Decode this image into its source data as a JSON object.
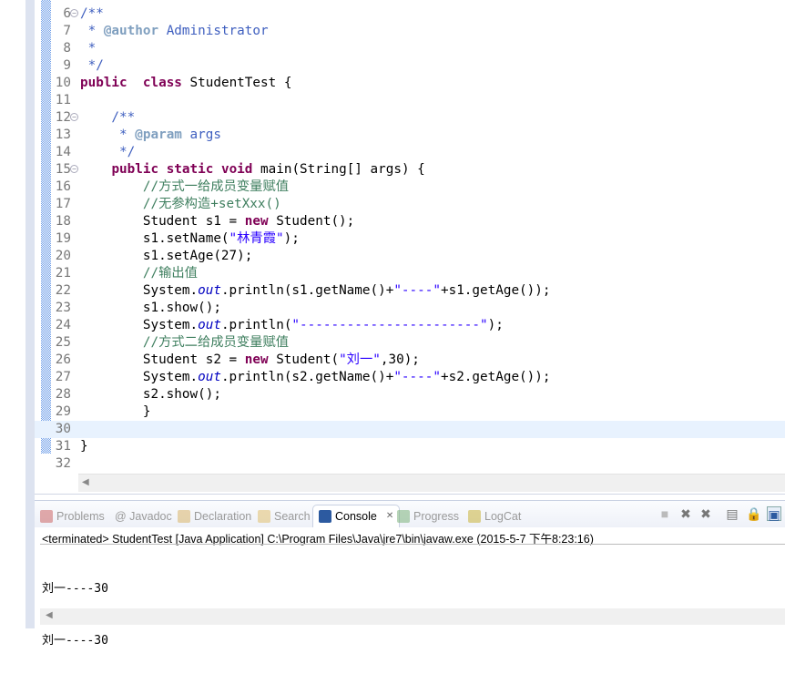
{
  "editor": {
    "current_line": 30,
    "lines": [
      {
        "n": "6",
        "fold": true,
        "t": [
          [
            "jd",
            "/**"
          ]
        ]
      },
      {
        "n": "7",
        "t": [
          [
            "jd",
            " * "
          ],
          [
            "tag",
            "@author"
          ],
          [
            "jd",
            " Administrator"
          ]
        ]
      },
      {
        "n": "8",
        "t": [
          [
            "jd",
            " *"
          ]
        ]
      },
      {
        "n": "9",
        "t": [
          [
            "jd",
            " */"
          ]
        ]
      },
      {
        "n": "10",
        "t": [
          [
            "kw",
            "public"
          ],
          [
            "",
            "  "
          ],
          [
            "kw",
            "class"
          ],
          [
            "",
            " StudentTest {"
          ]
        ]
      },
      {
        "n": "11",
        "t": []
      },
      {
        "n": "12",
        "fold": true,
        "t": [
          [
            "jd",
            "    /**"
          ]
        ]
      },
      {
        "n": "13",
        "t": [
          [
            "jd",
            "     * "
          ],
          [
            "tag",
            "@param"
          ],
          [
            "jd",
            " args"
          ]
        ]
      },
      {
        "n": "14",
        "t": [
          [
            "jd",
            "     */"
          ]
        ]
      },
      {
        "n": "15",
        "fold": true,
        "t": [
          [
            "",
            "    "
          ],
          [
            "kw",
            "public"
          ],
          [
            "",
            " "
          ],
          [
            "kw",
            "static"
          ],
          [
            "",
            " "
          ],
          [
            "kw",
            "void"
          ],
          [
            "",
            " main(String[] args) {"
          ]
        ]
      },
      {
        "n": "16",
        "t": [
          [
            "cm",
            "        //方式一给成员变量赋值"
          ]
        ]
      },
      {
        "n": "17",
        "t": [
          [
            "cm",
            "        //无参构造+setXxx()"
          ]
        ]
      },
      {
        "n": "18",
        "t": [
          [
            "",
            "        Student s1 = "
          ],
          [
            "kw",
            "new"
          ],
          [
            "",
            " Student();"
          ]
        ]
      },
      {
        "n": "19",
        "t": [
          [
            "",
            "        s1.setName("
          ],
          [
            "str",
            "\"林青霞\""
          ],
          [
            "",
            ");"
          ]
        ]
      },
      {
        "n": "20",
        "t": [
          [
            "",
            "        s1.setAge(27);"
          ]
        ]
      },
      {
        "n": "21",
        "t": [
          [
            "cm",
            "        //输出值"
          ]
        ]
      },
      {
        "n": "22",
        "t": [
          [
            "",
            "        System."
          ],
          [
            "fld",
            "out"
          ],
          [
            "",
            ".println(s1.getName()+"
          ],
          [
            "str",
            "\"----\""
          ],
          [
            "",
            "+s1.getAge());"
          ]
        ]
      },
      {
        "n": "23",
        "t": [
          [
            "",
            "        s1.show();"
          ]
        ]
      },
      {
        "n": "24",
        "t": [
          [
            "",
            "        System."
          ],
          [
            "fld",
            "out"
          ],
          [
            "",
            ".println("
          ],
          [
            "str",
            "\"-----------------------\""
          ],
          [
            "",
            ");"
          ]
        ]
      },
      {
        "n": "25",
        "t": [
          [
            "cm",
            "        //方式二给成员变量赋值"
          ]
        ]
      },
      {
        "n": "26",
        "t": [
          [
            "",
            "        Student s2 = "
          ],
          [
            "kw",
            "new"
          ],
          [
            "",
            " Student("
          ],
          [
            "str",
            "\"刘一\""
          ],
          [
            "",
            ",30);"
          ]
        ]
      },
      {
        "n": "27",
        "t": [
          [
            "",
            "        System."
          ],
          [
            "fld",
            "out"
          ],
          [
            "",
            ".println(s2.getName()+"
          ],
          [
            "str",
            "\"----\""
          ],
          [
            "",
            "+s2.getAge());"
          ]
        ]
      },
      {
        "n": "28",
        "t": [
          [
            "",
            "        s2.show();"
          ]
        ]
      },
      {
        "n": "29",
        "t": [
          [
            "",
            "        }"
          ]
        ]
      },
      {
        "n": "30",
        "t": []
      },
      {
        "n": "31",
        "t": [
          [
            "",
            "}"
          ]
        ]
      },
      {
        "n": "32",
        "t": []
      }
    ]
  },
  "panel": {
    "tabs": [
      {
        "label": "Problems",
        "icon": "problems-icon",
        "color": "#c66"
      },
      {
        "label": "@ Javadoc",
        "icon": "",
        "color": ""
      },
      {
        "label": "Declaration",
        "icon": "declaration-icon",
        "color": "#d9b56a"
      },
      {
        "label": "Search",
        "icon": "search-icon",
        "color": "#e0c070"
      },
      {
        "label": "Console",
        "icon": "console-icon",
        "color": "#2c5aa0",
        "active": true
      },
      {
        "label": "Progress",
        "icon": "progress-icon",
        "color": "#7bb37b"
      },
      {
        "label": "LogCat",
        "icon": "logcat-icon",
        "color": "#c9b23a"
      }
    ],
    "close_glyph": "✕",
    "toolbar": [
      {
        "name": "terminate-icon",
        "glyph": "■"
      },
      {
        "name": "remove-launch-icon",
        "glyph": "✖"
      },
      {
        "name": "remove-all-launches-icon",
        "glyph": "✖"
      },
      {
        "name": "clear-console-icon",
        "glyph": "▤"
      },
      {
        "name": "scroll-lock-icon",
        "glyph": "🔒"
      },
      {
        "name": "display-console-icon",
        "glyph": "▣"
      }
    ],
    "status": "<terminated> StudentTest [Java Application] C:\\Program Files\\Java\\jre7\\bin\\javaw.exe (2015-5-7 下午8:23:16)",
    "output": [
      "刘一----30",
      "刘一----30"
    ]
  }
}
